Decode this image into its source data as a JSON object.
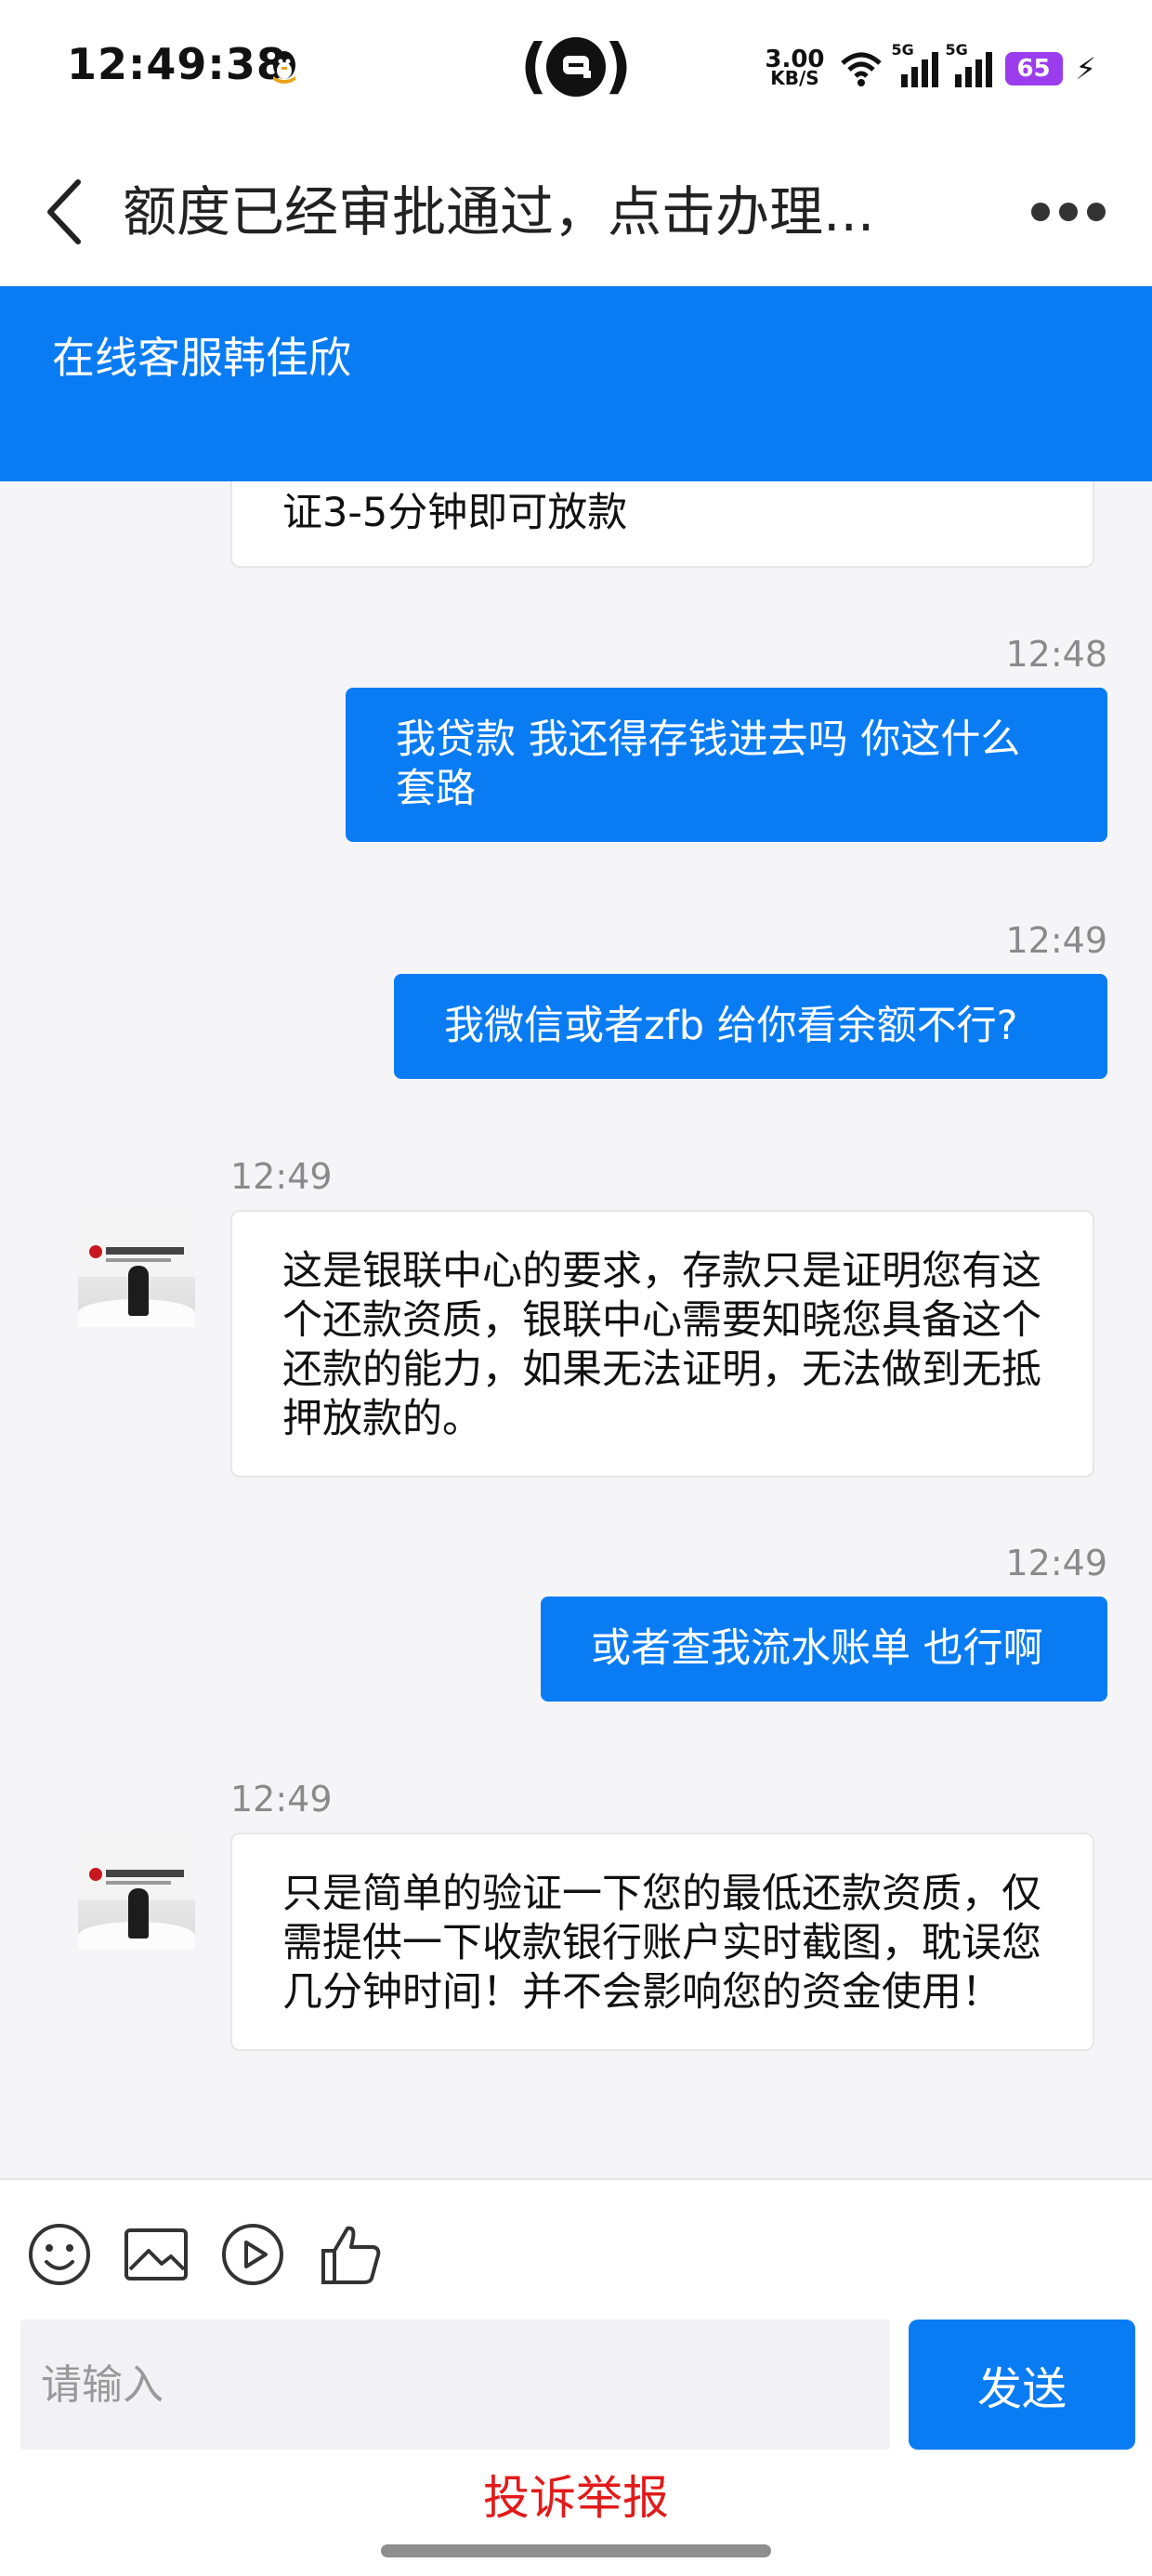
{
  "status_bar": {
    "time": "12:49:38",
    "net_speed_value": "3.00",
    "net_speed_unit": "KB/S",
    "network_1": "5G",
    "network_2": "5G",
    "battery": "65"
  },
  "nav": {
    "title": "额度已经审批通过，点击办理..."
  },
  "agent": {
    "name": "在线客服韩佳欣"
  },
  "messages": [
    {
      "side": "in",
      "time": "",
      "text": "证3-5分钟即可放款"
    },
    {
      "side": "out",
      "time": "12:48",
      "text": "我贷款 我还得存钱进去吗 你这什么套路"
    },
    {
      "side": "out",
      "time": "12:49",
      "text": "我微信或者zfb 给你看余额不行?"
    },
    {
      "side": "in",
      "time": "12:49",
      "text": "这是银联中心的要求，存款只是证明您有这个还款资质，银联中心需要知晓您具备这个还款的能力，如果无法证明，无法做到无抵押放款的。"
    },
    {
      "side": "out",
      "time": "12:49",
      "text": "或者查我流水账单 也行啊"
    },
    {
      "side": "in",
      "time": "12:49",
      "text": "只是简单的验证一下您的最低还款资质，仅需提供一下收款银行账户实时截图，耽误您几分钟时间！并不会影响您的资金使用！"
    }
  ],
  "composer": {
    "placeholder": "请输入",
    "send_label": "发送",
    "report_label": "投诉举报"
  },
  "colors": {
    "accent": "#0a7cf3",
    "report": "#e21a1a",
    "battery": "#9b3ded"
  },
  "icons": [
    "back-arrow-icon",
    "more-icon",
    "emoji-icon",
    "image-icon",
    "video-icon",
    "thumbs-up-icon",
    "qq-icon"
  ]
}
